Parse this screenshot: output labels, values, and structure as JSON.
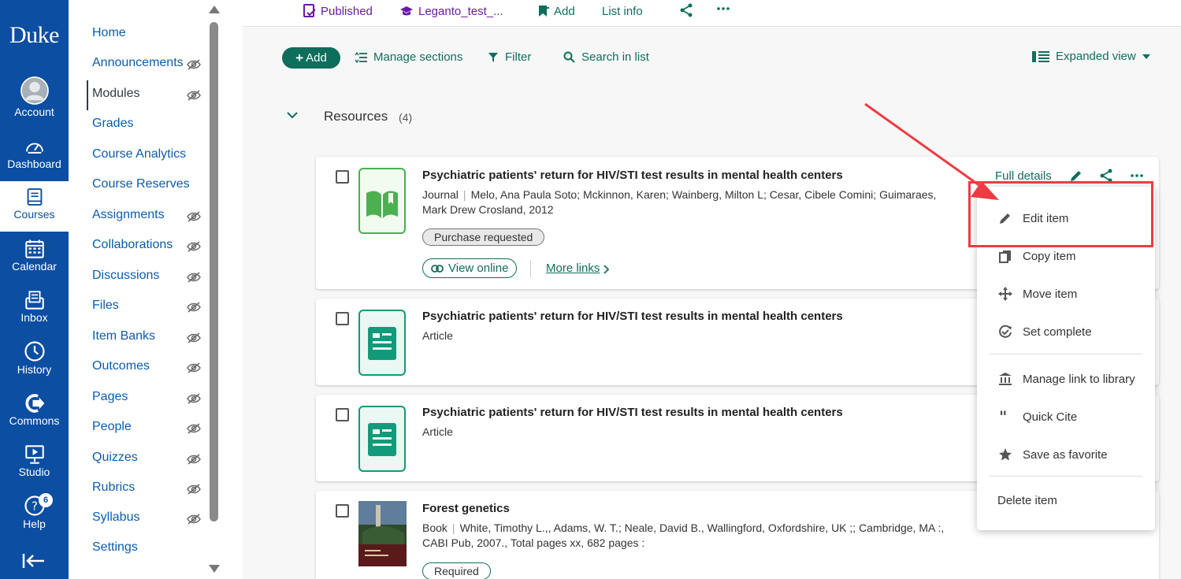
{
  "global_nav": {
    "logo": "Duke",
    "items": [
      {
        "label": "Account",
        "icon": "avatar-icon"
      },
      {
        "label": "Dashboard",
        "icon": "dashboard-icon"
      },
      {
        "label": "Courses",
        "icon": "book-icon"
      },
      {
        "label": "Calendar",
        "icon": "calendar-icon"
      },
      {
        "label": "Inbox",
        "icon": "inbox-icon"
      },
      {
        "label": "History",
        "icon": "clock-icon"
      },
      {
        "label": "Commons",
        "icon": "commons-icon"
      },
      {
        "label": "Studio",
        "icon": "studio-icon"
      },
      {
        "label": "Help",
        "icon": "help-icon",
        "badge": "6"
      }
    ],
    "collapse_icon": "collapse-icon",
    "active": "Courses"
  },
  "course_nav": {
    "items": [
      {
        "label": "Home",
        "hidden": false
      },
      {
        "label": "Announcements",
        "hidden": true
      },
      {
        "label": "Modules",
        "hidden": true
      },
      {
        "label": "Grades",
        "hidden": false
      },
      {
        "label": "Course Analytics",
        "hidden": false
      },
      {
        "label": "Course Reserves",
        "hidden": false
      },
      {
        "label": "Assignments",
        "hidden": true
      },
      {
        "label": "Collaborations",
        "hidden": true
      },
      {
        "label": "Discussions",
        "hidden": true
      },
      {
        "label": "Files",
        "hidden": true
      },
      {
        "label": "Item Banks",
        "hidden": true
      },
      {
        "label": "Outcomes",
        "hidden": true
      },
      {
        "label": "Pages",
        "hidden": true
      },
      {
        "label": "People",
        "hidden": true
      },
      {
        "label": "Quizzes",
        "hidden": true
      },
      {
        "label": "Rubrics",
        "hidden": true
      },
      {
        "label": "Syllabus",
        "hidden": true
      },
      {
        "label": "Settings",
        "hidden": false
      }
    ],
    "active": "Modules"
  },
  "top_bar": {
    "published": "Published",
    "list_name": "Leganto_test_...",
    "add": "Add",
    "list_info": "List info"
  },
  "toolbar": {
    "add_label": "Add",
    "manage_sections": "Manage sections",
    "filter": "Filter",
    "search": "Search in list",
    "view": "Expanded view"
  },
  "section": {
    "title": "Resources",
    "count": "(4)"
  },
  "cards": [
    {
      "title": "Psychiatric patients' return for HIV/STI test results in mental health centers",
      "type": "Journal",
      "authors_line1": "Melo, Ana Paula Soto; Mckinnon, Karen; Wainberg, Milton L; Cesar, Cibele Comini; Guimaraes,",
      "authors_line2": "Mark Drew Crosland, 2012",
      "tag": "Purchase requested",
      "view_online": "View online",
      "more_links": "More links",
      "full_details": "Full details"
    },
    {
      "title": "Psychiatric patients' return for HIV/STI test results in mental health centers",
      "type": "Article"
    },
    {
      "title": "Psychiatric patients' return for HIV/STI test results in mental health centers",
      "type": "Article"
    },
    {
      "title": "Forest genetics",
      "type": "Book",
      "authors_line1": "White, Timothy L.,, Adams, W. T.; Neale, David B., Wallingford, Oxfordshire, UK ;; Cambridge, MA :,",
      "authors_line2": "CABI Pub, 2007., Total pages xx, 682 pages :",
      "tag": "Required"
    }
  ],
  "menu": {
    "items": [
      {
        "label": "Edit item",
        "icon": "pencil-icon"
      },
      {
        "label": "Copy item",
        "icon": "copy-icon"
      },
      {
        "label": "Move item",
        "icon": "move-icon"
      },
      {
        "label": "Set complete",
        "icon": "complete-icon"
      },
      {
        "label": "Manage link to library",
        "icon": "library-icon"
      },
      {
        "label": "Quick Cite",
        "icon": "quote-icon"
      },
      {
        "label": "Save as favorite",
        "icon": "star-icon"
      },
      {
        "label": "Delete item",
        "icon": ""
      }
    ]
  },
  "colors": {
    "global_nav": "#0b4ea2",
    "accent": "#0e6e5c",
    "published": "#6b1aa1",
    "annotation": "#ee3b43"
  }
}
